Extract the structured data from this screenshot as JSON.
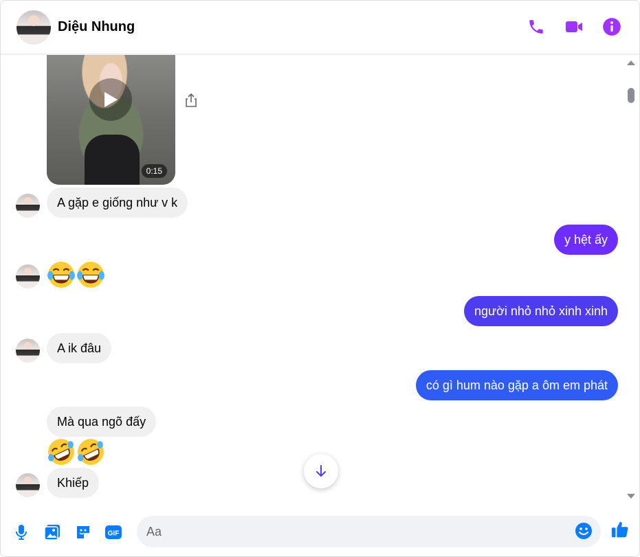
{
  "colors": {
    "accent": "#a033ff",
    "blue": "#0a7cff",
    "out_bubble_1": "#6e2dff",
    "out_bubble_2": "#4d3cf0",
    "out_bubble_3": "#2f5cf5"
  },
  "header": {
    "contact_name": "Diệu Nhung",
    "icons": [
      "phone-icon",
      "video-call-icon",
      "info-icon"
    ]
  },
  "video": {
    "duration": "0:15"
  },
  "messages": [
    {
      "side": "in",
      "text": "A gặp e giống như v k"
    },
    {
      "side": "out",
      "text": "y hệt ấy"
    },
    {
      "side": "in",
      "emoji": "😂😂"
    },
    {
      "side": "out",
      "text": "người nhỏ nhỏ xinh xinh"
    },
    {
      "side": "in",
      "text": "A ik đâu"
    },
    {
      "side": "out",
      "text": "có gì hum nào gặp a ôm em phát"
    },
    {
      "side": "in",
      "text": "Mà qua ngõ đấy"
    },
    {
      "side": "in",
      "emoji": "🤣🤣"
    },
    {
      "side": "in",
      "text": "Khiếp"
    }
  ],
  "composer": {
    "placeholder": "Aa",
    "icons": [
      "microphone-icon",
      "photo-icon",
      "sticker-icon",
      "gif-icon",
      "emoji-icon",
      "like-icon"
    ]
  }
}
